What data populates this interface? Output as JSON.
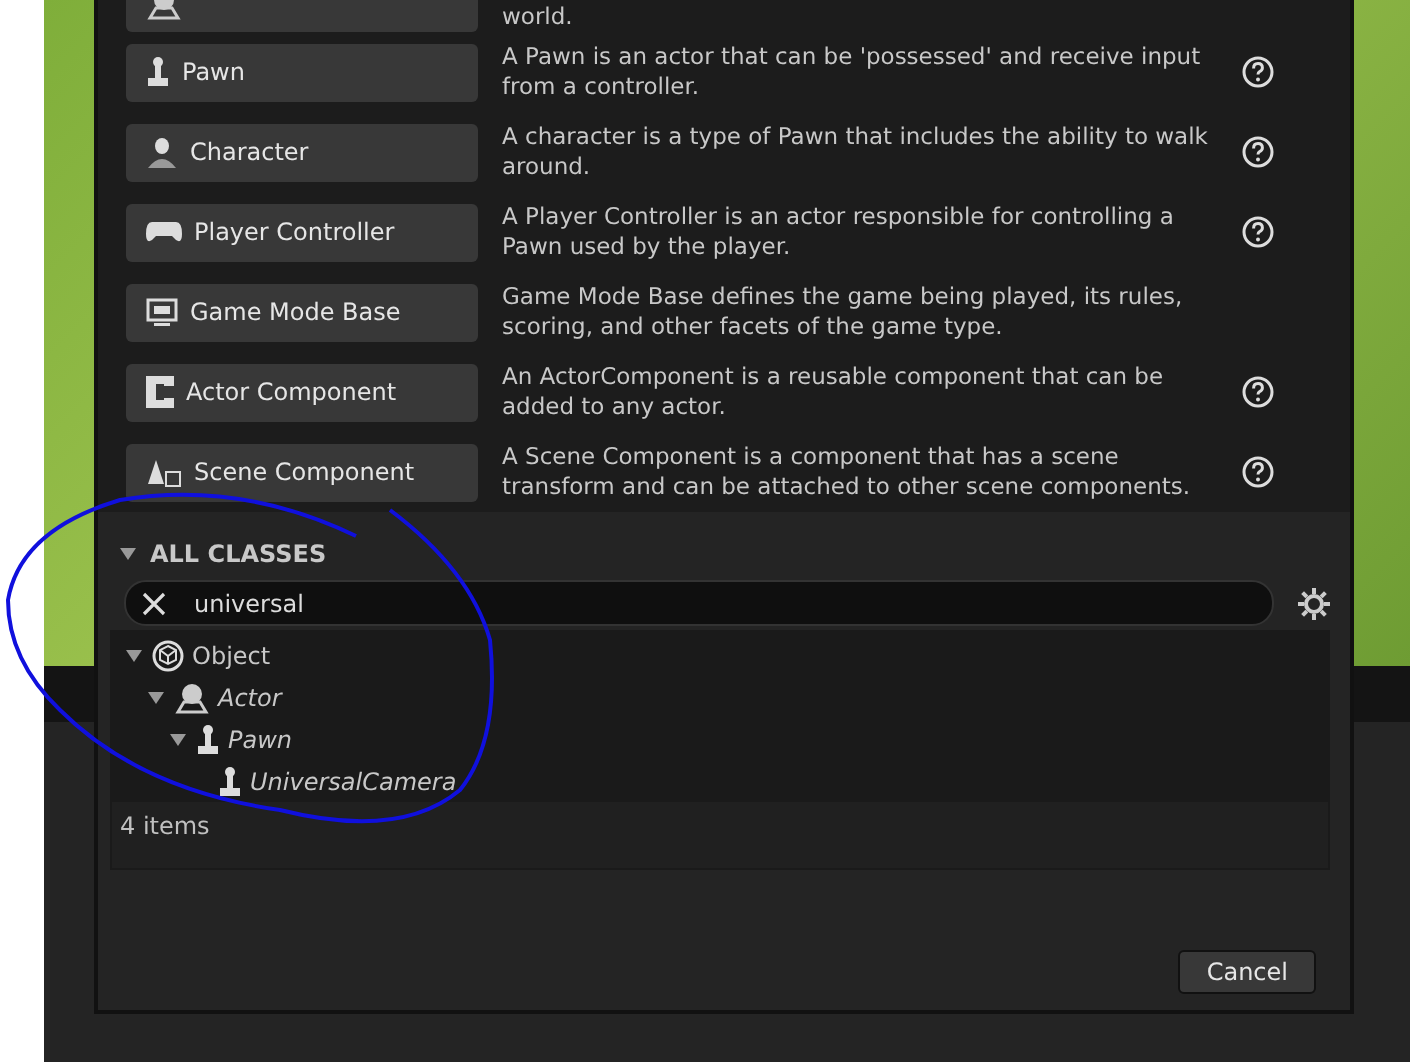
{
  "common_classes": [
    {
      "kind": "actor",
      "description": "world."
    },
    {
      "kind": "pawn",
      "label": "Pawn",
      "description": "A Pawn is an actor that can be 'possessed' and receive input from a controller.",
      "help": true
    },
    {
      "kind": "character",
      "label": "Character",
      "description": "A character is a type of Pawn that includes the ability to walk around.",
      "help": true
    },
    {
      "kind": "controller",
      "label": "Player Controller",
      "description": "A Player Controller is an actor responsible for controlling a Pawn used by the player.",
      "help": true
    },
    {
      "kind": "gamemode",
      "label": "Game Mode Base",
      "description": "Game Mode Base defines the game being played, its rules, scoring, and other facets of the game type.",
      "help": false
    },
    {
      "kind": "component",
      "label": "Actor Component",
      "description": "An ActorComponent is a reusable component that can be added to any actor.",
      "help": true
    },
    {
      "kind": "scene",
      "label": "Scene Component",
      "description": "A Scene Component is a component that has a scene transform and can be attached to other scene components.",
      "help": true
    }
  ],
  "all_classes": {
    "title": "ALL CLASSES",
    "expanded": true,
    "search": {
      "value": "universal"
    },
    "tree": [
      {
        "kind": "object",
        "label": "Object",
        "expanded": true,
        "children": [
          {
            "kind": "actor",
            "label": "Actor",
            "expanded": true,
            "children": [
              {
                "kind": "pawn",
                "label": "Pawn",
                "expanded": true,
                "children": [
                  {
                    "kind": "pawn",
                    "label": "UniversalCamera"
                  }
                ]
              }
            ]
          }
        ]
      }
    ],
    "count": "4 items"
  },
  "buttons": [
    "Cancel"
  ]
}
